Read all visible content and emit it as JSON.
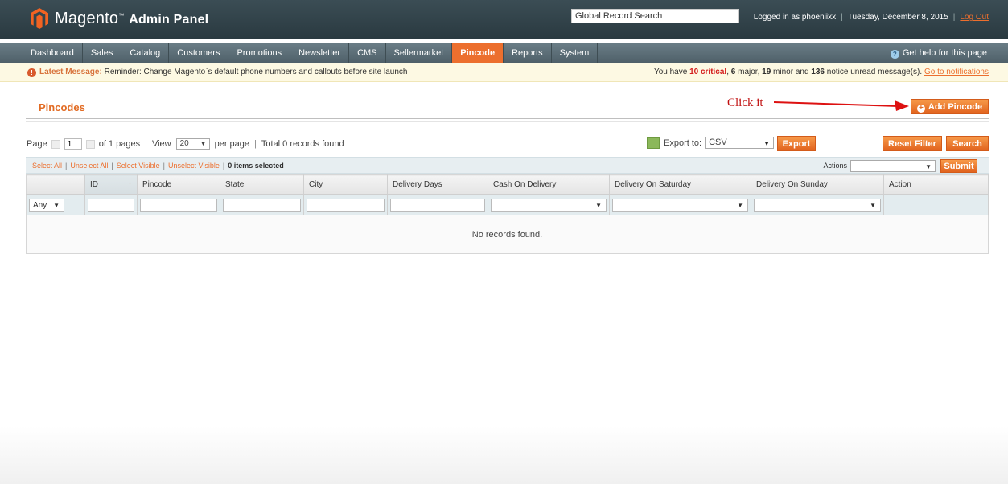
{
  "header": {
    "logo_brand": "Magento",
    "logo_product": "Admin Panel",
    "search_value": "Global Record Search",
    "logged_in": "Logged in as phoeniixx",
    "date": "Tuesday, December 8, 2015",
    "logout": "Log Out"
  },
  "nav": {
    "items": [
      "Dashboard",
      "Sales",
      "Catalog",
      "Customers",
      "Promotions",
      "Newsletter",
      "CMS",
      "Sellermarket",
      "Pincode",
      "Reports",
      "System"
    ],
    "active": "Pincode",
    "help": "Get help for this page"
  },
  "message": {
    "label": "Latest Message:",
    "text": "Reminder: Change Magento`s default phone numbers and callouts before site launch",
    "right_prefix": "You have",
    "critical": "10 critical",
    "major": "6",
    "major_text": "major,",
    "minor": "19",
    "minor_text": "minor and",
    "notice": "136",
    "notice_text": "notice unread message(s).",
    "link": "Go to notifications"
  },
  "page": {
    "title": "Pincodes",
    "annotation": "Click it",
    "add_button": "Add Pincode"
  },
  "toolbar": {
    "page_label": "Page",
    "page_value": "1",
    "of_pages": "of 1 pages",
    "view_label": "View",
    "view_value": "20",
    "per_page": "per page",
    "total": "Total 0 records found",
    "export_label": "Export to:",
    "export_format": "CSV",
    "export_button": "Export",
    "reset_button": "Reset Filter",
    "search_button": "Search"
  },
  "massaction": {
    "select_all": "Select All",
    "unselect_all": "Unselect All",
    "select_visible": "Select Visible",
    "unselect_visible": "Unselect Visible",
    "selected_count": "0",
    "selected_text": "items selected",
    "actions_label": "Actions",
    "submit_button": "Submit"
  },
  "grid": {
    "columns": [
      "ID",
      "Pincode",
      "State",
      "City",
      "Delivery Days",
      "Cash On Delivery",
      "Delivery On Saturday",
      "Delivery On Sunday",
      "Action"
    ],
    "any_option": "Any",
    "empty": "No records found."
  },
  "colors": {
    "accent": "#ec6f2e",
    "header_bg": "#2f4047",
    "annotation": "#c11111"
  }
}
